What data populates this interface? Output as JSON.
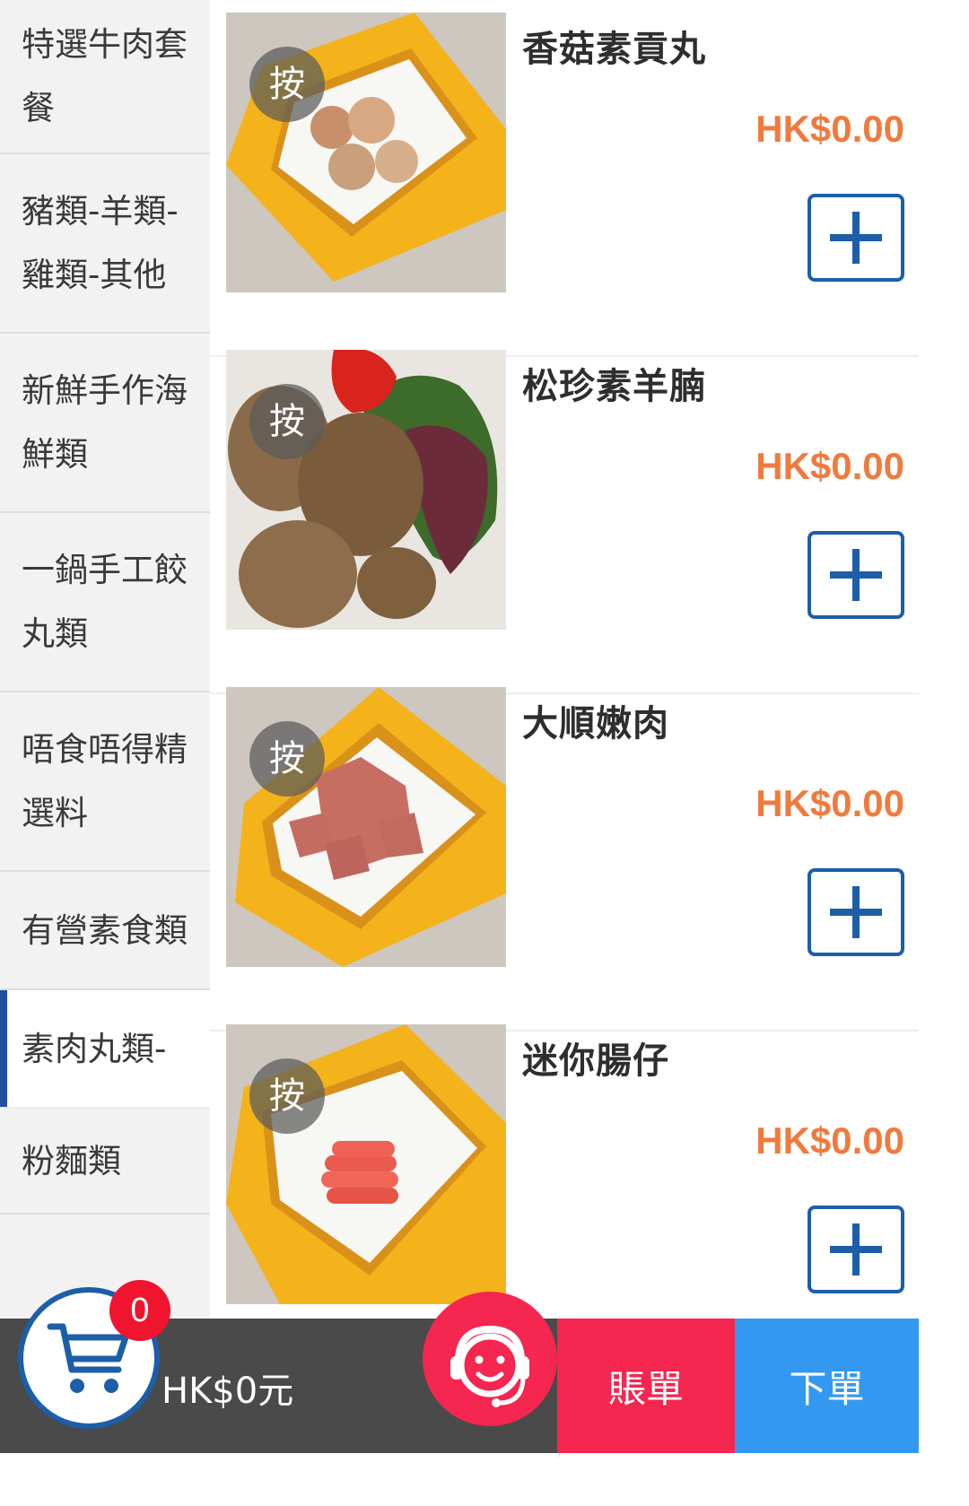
{
  "sidebar": {
    "categories": [
      {
        "line1": "特選牛肉套",
        "line2": "餐"
      },
      {
        "line1": "豬類-羊類-",
        "line2": "雞類-其他"
      },
      {
        "line1": "新鮮手作海",
        "line2": "鮮類"
      },
      {
        "line1": "一鍋手工餃",
        "line2": "丸類"
      },
      {
        "line1": "唔食唔得精",
        "line2": "選料"
      },
      {
        "line1": "有營素食類",
        "line2": ""
      },
      {
        "line1": "素肉丸類-",
        "line2": ""
      },
      {
        "line1": "粉麵類",
        "line2": ""
      }
    ],
    "active_index": 6,
    "active_color": "#1f4fa3"
  },
  "items": [
    {
      "name": "香菇素貢丸",
      "price": "HK$0.00",
      "badge": "按",
      "image_icon": "mushroom-vegetarian-balls-photo"
    },
    {
      "name": "松珍素羊腩",
      "price": "HK$0.00",
      "badge": "按",
      "image_icon": "vegetarian-lamb-brisket-photo"
    },
    {
      "name": "大順嫩肉",
      "price": "HK$0.00",
      "badge": "按",
      "image_icon": "luncheon-meat-photo"
    },
    {
      "name": "迷你腸仔",
      "price": "HK$0.00",
      "badge": "按",
      "image_icon": "mini-sausages-photo"
    }
  ],
  "cart": {
    "count": "0",
    "total": "HK$0元"
  },
  "actions": {
    "bill_label": "賬單",
    "order_label": "下單"
  },
  "colors": {
    "price": "#f07a3e",
    "add_button": "#1d5ea8",
    "bill_button": "#f5264f",
    "order_button": "#3399f0",
    "bottom_bar": "#4a4a4a",
    "badge": "#f0142e"
  }
}
